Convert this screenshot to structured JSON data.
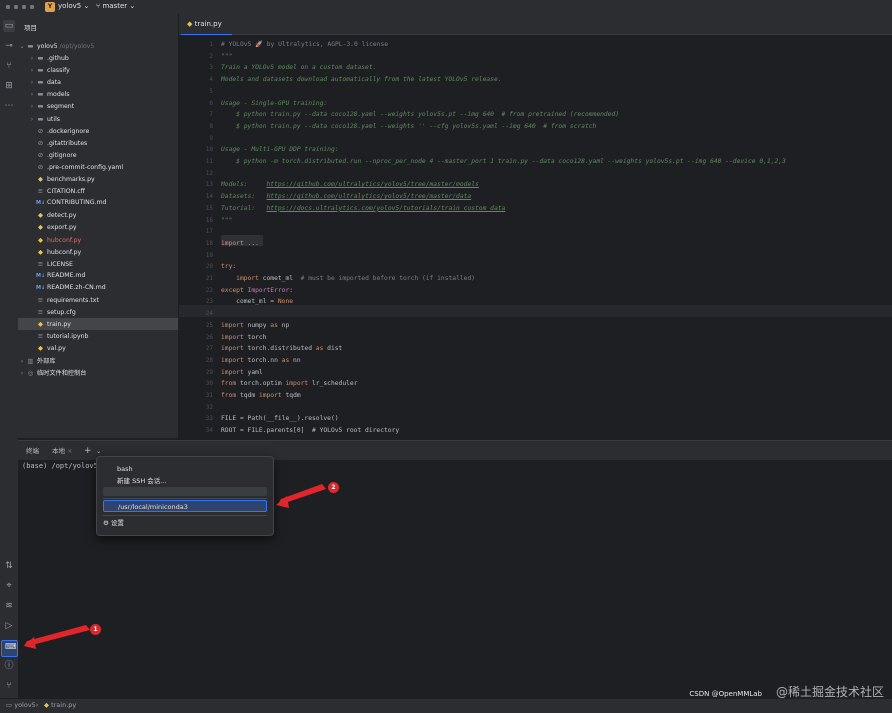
{
  "titlebar": {
    "project_badge": "Y",
    "project_name": "yolov5",
    "branch": "master"
  },
  "project_panel": {
    "title": "项目",
    "root": {
      "name": "yolov5",
      "path": "/opt/yolov5"
    },
    "items": [
      {
        "label": ".github",
        "kind": "folder"
      },
      {
        "label": "classify",
        "kind": "folder"
      },
      {
        "label": "data",
        "kind": "folder"
      },
      {
        "label": "models",
        "kind": "folder"
      },
      {
        "label": "segment",
        "kind": "folder"
      },
      {
        "label": "utils",
        "kind": "folder"
      },
      {
        "label": ".dockerignore",
        "kind": "ignore"
      },
      {
        "label": ".gitattributes",
        "kind": "ignore"
      },
      {
        "label": ".gitignore",
        "kind": "ignore"
      },
      {
        "label": ".pre-commit-config.yaml",
        "kind": "yaml"
      },
      {
        "label": "benchmarks.py",
        "kind": "py"
      },
      {
        "label": "CITATION.cff",
        "kind": "txt"
      },
      {
        "label": "CONTRIBUTING.md",
        "kind": "md"
      },
      {
        "label": "detect.py",
        "kind": "py"
      },
      {
        "label": "export.py",
        "kind": "py"
      },
      {
        "label": "hubconf.py",
        "kind": "py",
        "modified": true
      },
      {
        "label": "hubconf.py",
        "kind": "py"
      },
      {
        "label": "LICENSE",
        "kind": "txt"
      },
      {
        "label": "README.md",
        "kind": "md"
      },
      {
        "label": "README.zh-CN.md",
        "kind": "md"
      },
      {
        "label": "requirements.txt",
        "kind": "txt"
      },
      {
        "label": "setup.cfg",
        "kind": "txt"
      },
      {
        "label": "train.py",
        "kind": "py",
        "selected": true
      },
      {
        "label": "tutorial.ipynb",
        "kind": "txt"
      },
      {
        "label": "val.py",
        "kind": "py"
      }
    ],
    "external_libs": "外部库",
    "scratches": "临时文件和控制台"
  },
  "editor": {
    "tab_label": "train.py",
    "lines": [
      {
        "n": "1",
        "segs": [
          {
            "t": "# YOLOv5 🚀 by Ultralytics, AGPL-3.0 license",
            "c": "cmt"
          }
        ]
      },
      {
        "n": "2",
        "segs": [
          {
            "t": "\"\"\"",
            "c": "doc"
          }
        ]
      },
      {
        "n": "3",
        "segs": [
          {
            "t": "Train a YOLOv5 model on a custom dataset.",
            "c": "doc"
          }
        ]
      },
      {
        "n": "4",
        "segs": [
          {
            "t": "Models and datasets download automatically from the latest YOLOv5 release.",
            "c": "doc"
          }
        ]
      },
      {
        "n": "5",
        "segs": []
      },
      {
        "n": "6",
        "segs": [
          {
            "t": "Usage - Single-GPU training:",
            "c": "doc"
          }
        ]
      },
      {
        "n": "7",
        "segs": [
          {
            "t": "    $ python train.py --data coco128.yaml --weights yolov5s.pt --img 640  # from pretrained (recommended)",
            "c": "doc"
          }
        ]
      },
      {
        "n": "8",
        "segs": [
          {
            "t": "    $ python train.py --data coco128.yaml --weights '' --cfg yolov5s.yaml --img 640  # from scratch",
            "c": "doc"
          }
        ]
      },
      {
        "n": "9",
        "segs": []
      },
      {
        "n": "10",
        "segs": [
          {
            "t": "Usage - Multi-GPU DDP training:",
            "c": "doc"
          }
        ]
      },
      {
        "n": "11",
        "segs": [
          {
            "t": "    $ python -m torch.distributed.run --nproc_per_node 4 --master_port 1 train.py --data coco128.yaml --weights yolov5s.pt --img 640 --device 0,1,2,3",
            "c": "doc"
          }
        ]
      },
      {
        "n": "12",
        "segs": []
      },
      {
        "n": "13",
        "segs": [
          {
            "t": "Models:     ",
            "c": "doc"
          },
          {
            "t": "https://github.com/ultralytics/yolov5/tree/master/models",
            "c": "url"
          }
        ]
      },
      {
        "n": "14",
        "segs": [
          {
            "t": "Datasets:   ",
            "c": "doc"
          },
          {
            "t": "https://github.com/ultralytics/yolov5/tree/master/data",
            "c": "url"
          }
        ]
      },
      {
        "n": "15",
        "segs": [
          {
            "t": "Tutorial:   ",
            "c": "doc"
          },
          {
            "t": "https://docs.ultralytics.com/yolov5/tutorials/train_custom_data",
            "c": "url"
          }
        ]
      },
      {
        "n": "16",
        "segs": [
          {
            "t": "\"\"\"",
            "c": "doc"
          }
        ]
      },
      {
        "n": "17",
        "segs": []
      },
      {
        "n": "18",
        "segs": [
          {
            "t": "import ...",
            "c": "kw"
          }
        ]
      },
      {
        "n": "19",
        "segs": []
      },
      {
        "n": "20",
        "segs": [
          {
            "t": "try:",
            "c": "kw"
          }
        ]
      },
      {
        "n": "21",
        "segs": [
          {
            "t": "    ",
            "c": "txt"
          },
          {
            "t": "import ",
            "c": "kw"
          },
          {
            "t": "comet_ml  ",
            "c": "txt"
          },
          {
            "t": "# must be imported before torch (if installed)",
            "c": "cmt"
          }
        ]
      },
      {
        "n": "22",
        "segs": [
          {
            "t": "except ",
            "c": "kw"
          },
          {
            "t": "ImportError",
            "c": "cls"
          },
          {
            "t": ":",
            "c": "txt"
          }
        ]
      },
      {
        "n": "23",
        "segs": [
          {
            "t": "    comet_ml = ",
            "c": "txt"
          },
          {
            "t": "None",
            "c": "kw"
          }
        ]
      },
      {
        "n": "24",
        "segs": []
      },
      {
        "n": "25",
        "segs": [
          {
            "t": "import ",
            "c": "kw"
          },
          {
            "t": "numpy ",
            "c": "txt"
          },
          {
            "t": "as ",
            "c": "kw"
          },
          {
            "t": "np",
            "c": "txt"
          }
        ]
      },
      {
        "n": "26",
        "segs": [
          {
            "t": "import ",
            "c": "kw"
          },
          {
            "t": "torch",
            "c": "txt"
          }
        ]
      },
      {
        "n": "27",
        "segs": [
          {
            "t": "import ",
            "c": "kw"
          },
          {
            "t": "torch.distributed ",
            "c": "txt"
          },
          {
            "t": "as ",
            "c": "kw"
          },
          {
            "t": "dist",
            "c": "txt"
          }
        ]
      },
      {
        "n": "28",
        "segs": [
          {
            "t": "import ",
            "c": "kw"
          },
          {
            "t": "torch.nn ",
            "c": "txt"
          },
          {
            "t": "as ",
            "c": "kw"
          },
          {
            "t": "nn",
            "c": "txt"
          }
        ]
      },
      {
        "n": "29",
        "segs": [
          {
            "t": "import ",
            "c": "kw"
          },
          {
            "t": "yaml",
            "c": "txt"
          }
        ]
      },
      {
        "n": "30",
        "segs": [
          {
            "t": "from ",
            "c": "kw"
          },
          {
            "t": "torch.optim ",
            "c": "txt"
          },
          {
            "t": "import ",
            "c": "kw"
          },
          {
            "t": "lr_scheduler",
            "c": "txt"
          }
        ]
      },
      {
        "n": "31",
        "segs": [
          {
            "t": "from ",
            "c": "kw"
          },
          {
            "t": "tqdm ",
            "c": "txt"
          },
          {
            "t": "import ",
            "c": "kw"
          },
          {
            "t": "tqdm",
            "c": "txt"
          }
        ]
      },
      {
        "n": "32",
        "segs": []
      },
      {
        "n": "33",
        "segs": [
          {
            "t": "FILE = Path(__file__).resolve()",
            "c": "txt"
          }
        ]
      },
      {
        "n": "34",
        "segs": [
          {
            "t": "ROOT = FILE.parents[0]  # YOLOv5 root directory",
            "c": "txt"
          }
        ]
      }
    ]
  },
  "terminal": {
    "tab_terminal": "终端",
    "tab_local": "本地",
    "add_symbol": "+",
    "dropdown_symbol": "⌄",
    "prompt": "(base) /opt/yolov5"
  },
  "dropdown": {
    "bash": "bash",
    "new_ssh": "新建 SSH 会话...",
    "conda": "/usr/local/miniconda3",
    "settings": "设置"
  },
  "annotations": {
    "one": "1",
    "two": "2"
  },
  "statusbar": {
    "project": "yolov5",
    "file": "train.py"
  },
  "watermark": {
    "main": "@稀土掘金技术社区",
    "sub": "CSDN @OpenMMLab"
  }
}
